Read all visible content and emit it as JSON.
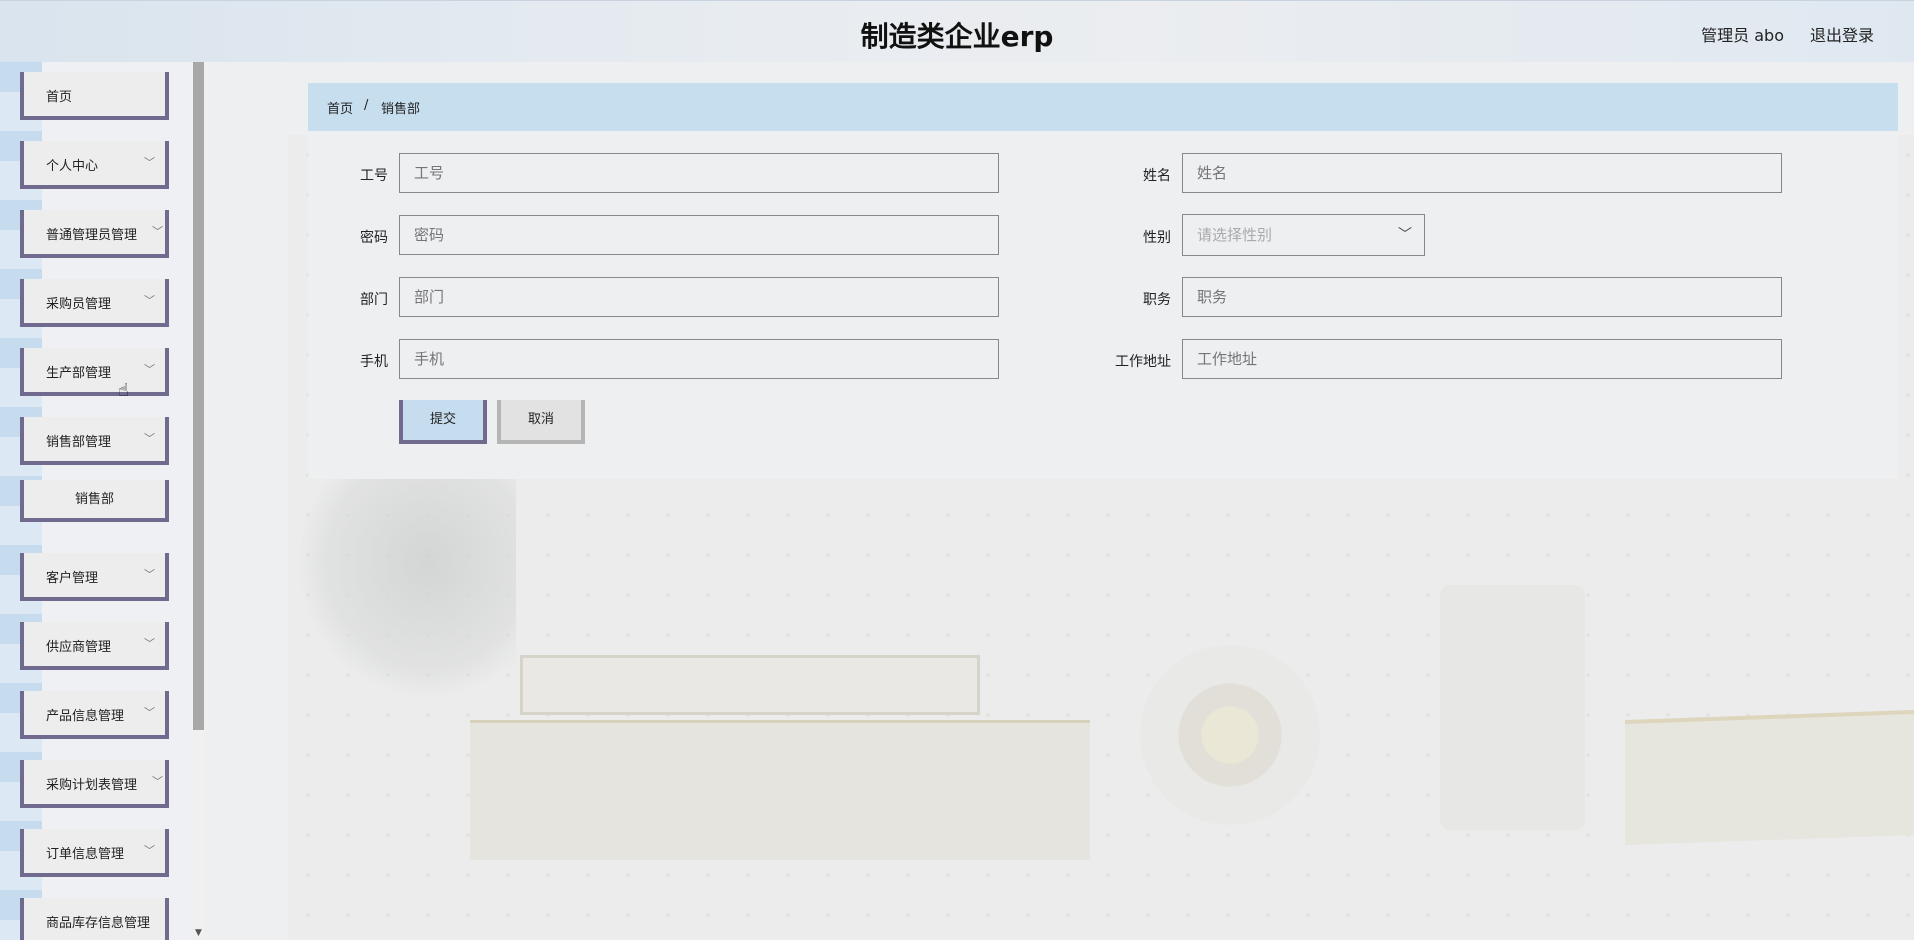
{
  "header": {
    "title": "制造类企业erp",
    "user": "管理员 abo",
    "logout": "退出登录"
  },
  "sidebar": {
    "items": [
      {
        "label": "首页",
        "has_children": false
      },
      {
        "label": "个人中心",
        "has_children": true
      },
      {
        "label": "普通管理员管理",
        "has_children": true
      },
      {
        "label": "采购员管理",
        "has_children": true
      },
      {
        "label": "生产部管理",
        "has_children": true
      },
      {
        "label": "销售部管理",
        "has_children": true,
        "expanded": true,
        "children": [
          {
            "label": "销售部"
          }
        ]
      },
      {
        "label": "客户管理",
        "has_children": true
      },
      {
        "label": "供应商管理",
        "has_children": true
      },
      {
        "label": "产品信息管理",
        "has_children": true
      },
      {
        "label": "采购计划表管理",
        "has_children": true
      },
      {
        "label": "订单信息管理",
        "has_children": true
      },
      {
        "label": "商品库存信息管理",
        "has_children": true
      }
    ],
    "chevron_icon": "chevron-down-icon"
  },
  "breadcrumb": {
    "home": "首页",
    "separator": "/",
    "current": "销售部"
  },
  "form": {
    "fields": {
      "job_no": {
        "label": "工号",
        "placeholder": "工号"
      },
      "name": {
        "label": "姓名",
        "placeholder": "姓名"
      },
      "password": {
        "label": "密码",
        "placeholder": "密码"
      },
      "gender": {
        "label": "性别",
        "placeholder": "请选择性别"
      },
      "department": {
        "label": "部门",
        "placeholder": "部门"
      },
      "position": {
        "label": "职务",
        "placeholder": "职务"
      },
      "phone": {
        "label": "手机",
        "placeholder": "手机"
      },
      "work_address": {
        "label": "工作地址",
        "placeholder": "工作地址"
      }
    },
    "submit_label": "提交",
    "cancel_label": "取消"
  },
  "colors": {
    "accent_border": "#6f6a8e",
    "breadcrumb_bg": "#c7deef",
    "submit_bg": "#c5ddef"
  }
}
